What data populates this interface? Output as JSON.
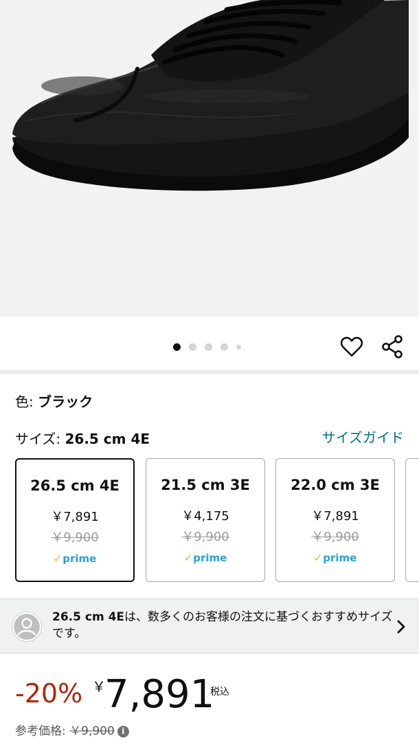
{
  "gallery": {
    "image_count": 5,
    "active_index": 0
  },
  "product": {
    "color_label": "色: ",
    "color_value": "ブラック",
    "size_label": "サイズ: ",
    "size_value": "26.5 cm 4E",
    "size_guide": "サイズガイド"
  },
  "size_options": [
    {
      "size": "26.5 cm 4E",
      "price": "￥7,891",
      "list_price": "￥9,900",
      "prime_check": "✓",
      "prime": "prime",
      "selected": true
    },
    {
      "size": "21.5 cm 3E",
      "price": "￥4,175",
      "list_price": "￥9,900",
      "prime_check": "✓",
      "prime": "prime",
      "selected": false
    },
    {
      "size": "22.0 cm 3E",
      "price": "￥7,891",
      "list_price": "￥9,900",
      "prime_check": "✓",
      "prime": "prime",
      "selected": false
    }
  ],
  "recommendation": {
    "size": "26.5 cm 4E",
    "text": "は、数多くのお客様の注文に基づくおすすめサイズです。"
  },
  "price": {
    "discount": "-20%",
    "currency": "￥",
    "amount": "7,891",
    "tax_note": "税込",
    "reference_label": "参考価格: ",
    "reference_price": "￥9,900",
    "info_glyph": "i"
  },
  "colors": {
    "link": "#007185",
    "discount": "#b12704",
    "prime": "#2f9fd7",
    "divider": "#eaeded"
  },
  "icons": [
    "heart-icon",
    "share-icon",
    "user-avatar-icon",
    "chevron-right-icon",
    "info-icon"
  ]
}
